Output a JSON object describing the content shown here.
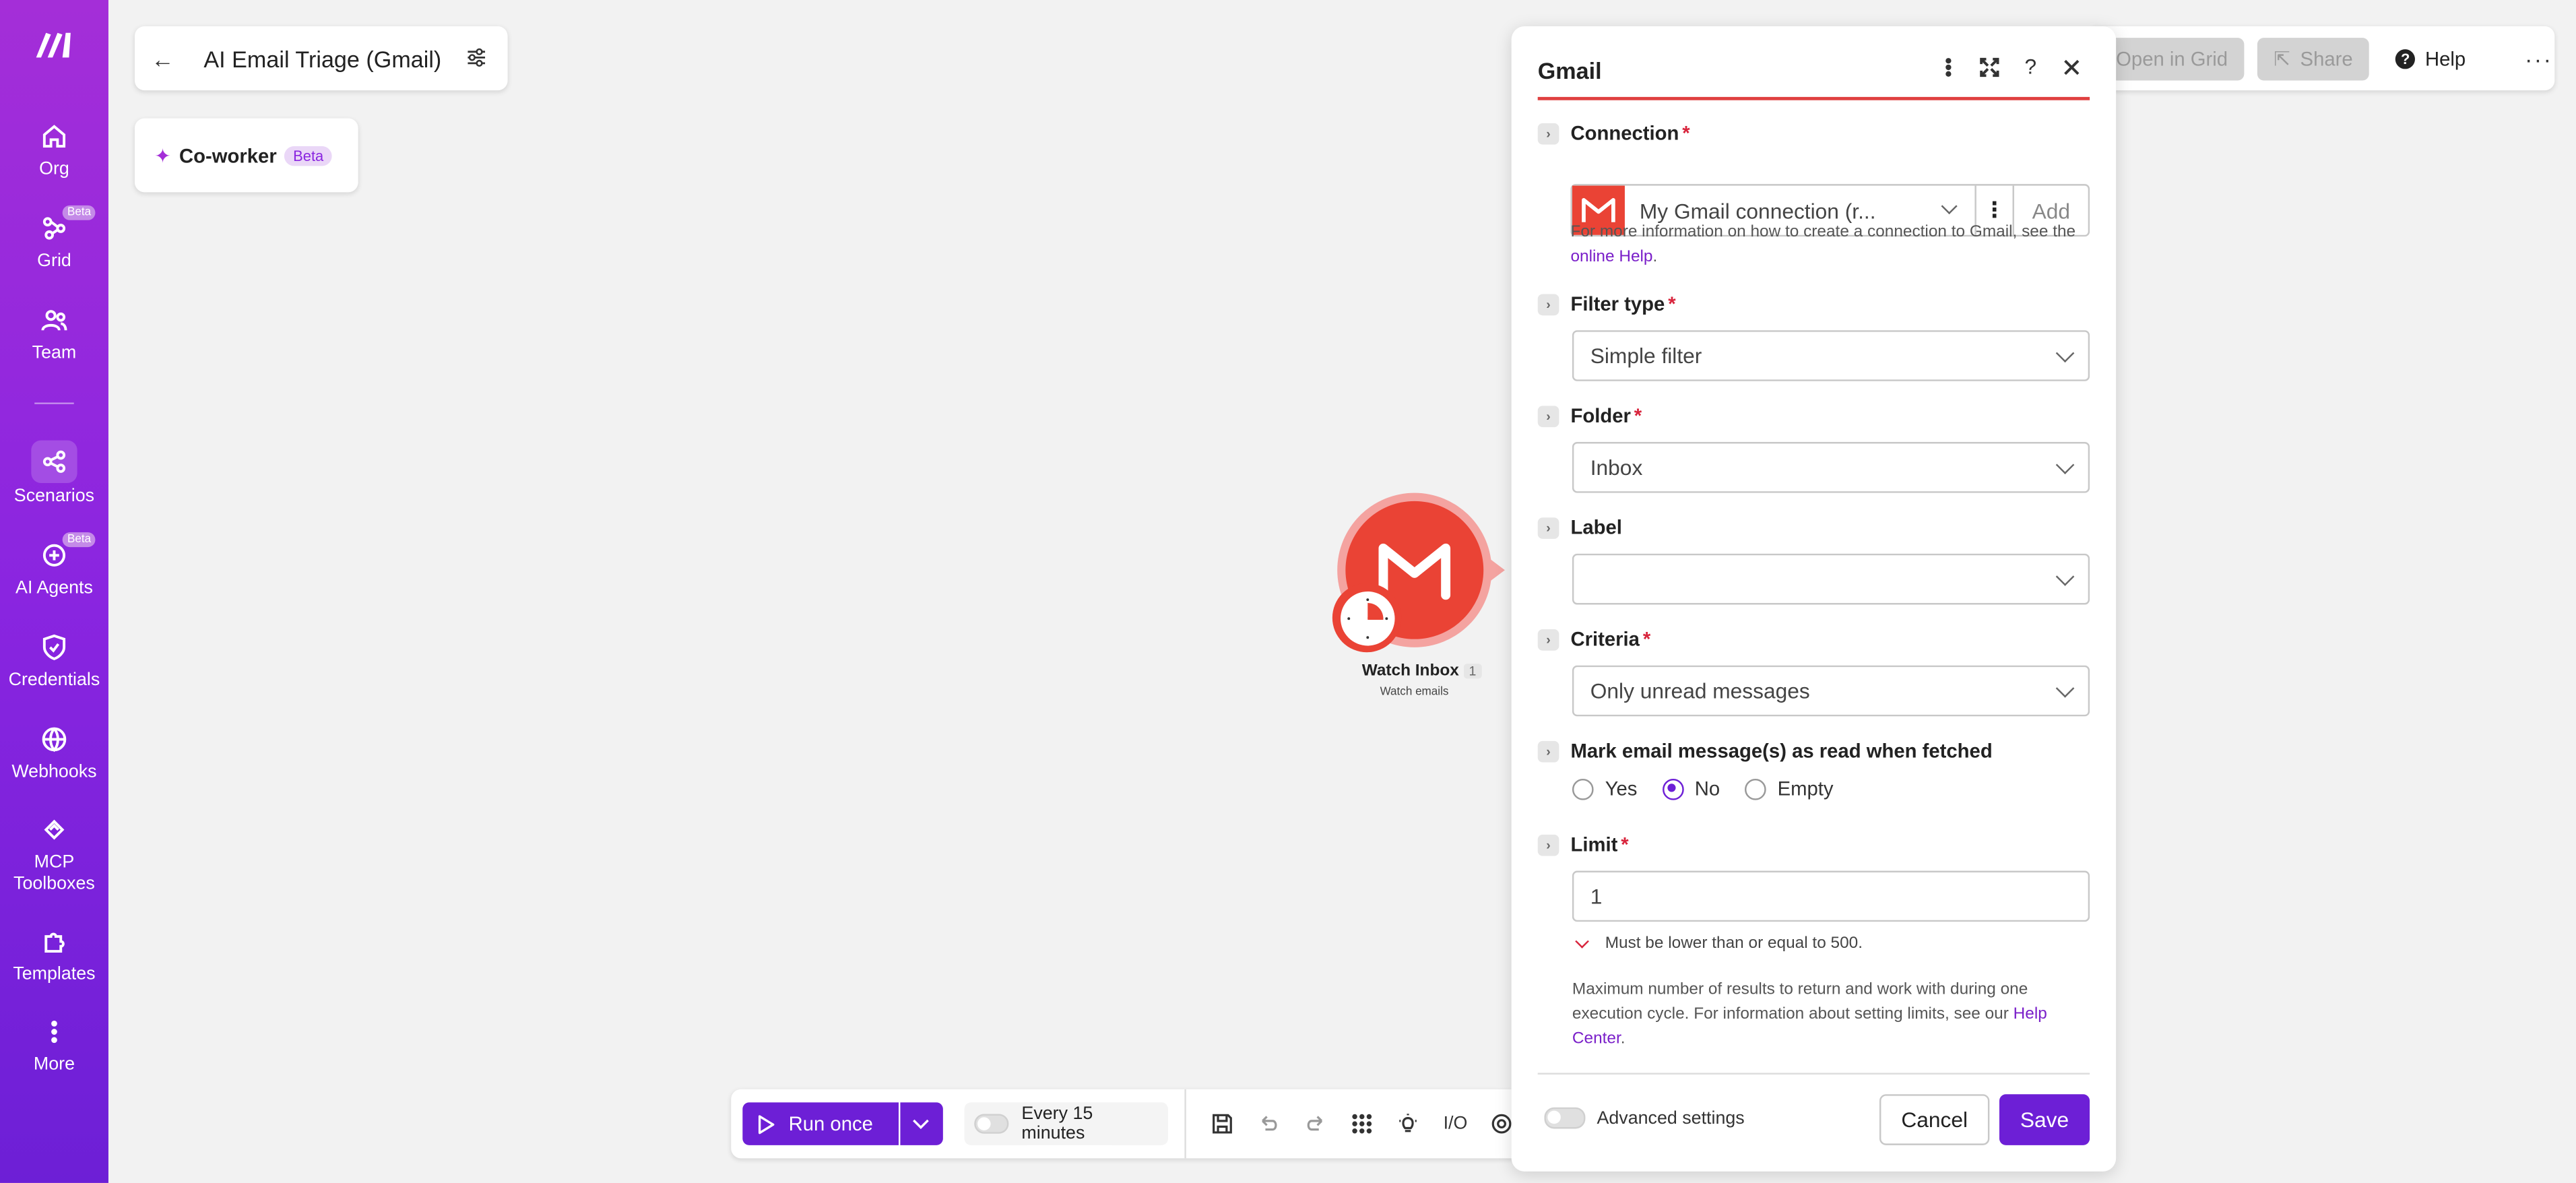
{
  "sidebar": {
    "items": [
      {
        "label": "Org",
        "icon": "home-icon"
      },
      {
        "label": "Grid",
        "icon": "grid-icon",
        "badge": "Beta"
      },
      {
        "label": "Team",
        "icon": "team-icon"
      },
      {
        "label": "Scenarios",
        "icon": "scenarios-icon",
        "active": true
      },
      {
        "label": "AI Agents",
        "icon": "ai-agents-icon",
        "badge": "Beta"
      },
      {
        "label": "Credentials",
        "icon": "shield-icon"
      },
      {
        "label": "Webhooks",
        "icon": "globe-icon"
      },
      {
        "label": "MCP Toolboxes",
        "label_line1": "MCP",
        "label_line2": "Toolboxes",
        "icon": "mcp-icon"
      },
      {
        "label": "Templates",
        "icon": "puzzle-icon"
      },
      {
        "label": "More",
        "icon": "more-vertical-icon"
      }
    ]
  },
  "header": {
    "title": "AI Email Triage (Gmail)"
  },
  "coworker": {
    "label": "Co-worker",
    "badge": "Beta"
  },
  "topbar": {
    "open_in_grid": "Open in Grid",
    "share": "Share",
    "help": "Help"
  },
  "node": {
    "title": "Watch Inbox",
    "number": "1",
    "subtitle": "Watch emails"
  },
  "bottombar": {
    "run_once": "Run once",
    "schedule": "Every 15 minutes"
  },
  "panel": {
    "title": "Gmail",
    "connection": {
      "label": "Connection",
      "value": "My Gmail connection (r...",
      "add": "Add",
      "help_prefix": "For more information on how to create a connection to Gmail, see the ",
      "help_link": "online Help",
      "help_suffix": "."
    },
    "filter_type": {
      "label": "Filter type",
      "value": "Simple filter"
    },
    "folder": {
      "label": "Folder",
      "value": "Inbox"
    },
    "label": {
      "label": "Label",
      "value": ""
    },
    "criteria": {
      "label": "Criteria",
      "value": "Only unread messages"
    },
    "mark_read": {
      "label": "Mark email message(s) as read when fetched",
      "options": [
        "Yes",
        "No",
        "Empty"
      ],
      "selected": "No"
    },
    "limit": {
      "label": "Limit",
      "value": "1",
      "warning": "Must be lower than or equal to 500.",
      "help_prefix": "Maximum number of results to return and work with during one execution cycle. For information about setting limits, see our ",
      "help_link": "Help Center",
      "help_suffix": "."
    },
    "advanced_settings": "Advanced settings",
    "cancel": "Cancel",
    "save": "Save"
  },
  "colors": {
    "brand_purple": "#6d1fd6",
    "gmail_red": "#ea4335",
    "required_red": "#d8243c"
  }
}
